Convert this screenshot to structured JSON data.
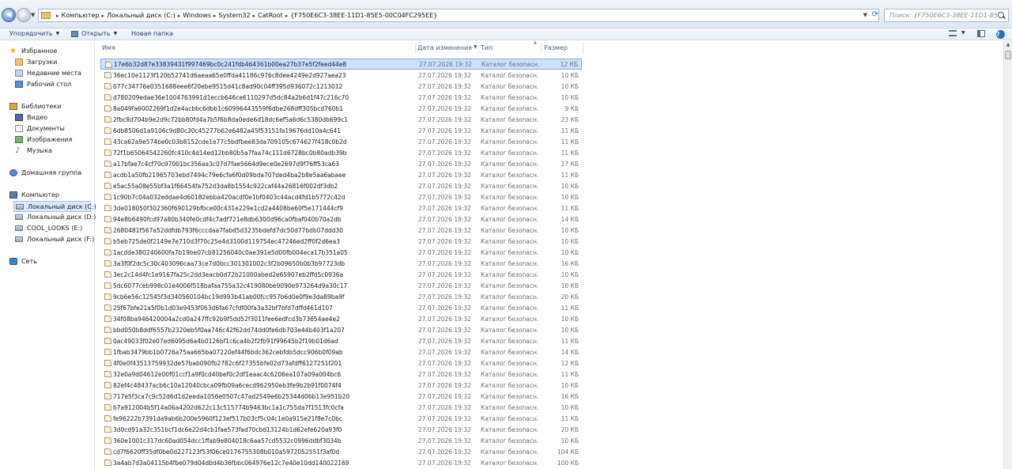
{
  "address": {
    "crumbs": [
      "Компьютер",
      "Локальный диск (C:)",
      "Windows",
      "System32",
      "CatRoot",
      "{F750E6C3-38EE-11D1-85E5-00C04FC295EE}"
    ],
    "search_placeholder": "Поиск: {F750E6C3-38EE-11D1-85E5-00..."
  },
  "toolbar": {
    "organize": "Упорядочить",
    "open": "Открыть",
    "new_folder": "Новая папка"
  },
  "nav": {
    "favorites": "Избранное",
    "downloads": "Загрузки",
    "recent": "Недавние места",
    "desktop": "Рабочий стол",
    "libraries": "Библиотеки",
    "video": "Видео",
    "documents": "Документы",
    "images": "Изображения",
    "music": "Музыка",
    "homegroup": "Домашняя группа",
    "computer": "Компьютер",
    "drive_c": "Локальный диск (C:)",
    "drive_d": "Локальный диск (D:)",
    "drive_e": "COOL_LOOKS (E:)",
    "drive_f": "Локальный диск (F:)",
    "network": "Сеть"
  },
  "columns": {
    "name": "Имя",
    "date": "Дата изменения",
    "type": "Тип",
    "size": "Размер"
  },
  "rows": [
    {
      "name": "17e6b32d87e33839431f997469bc0c241fdb464361b00ea27b37e5f2feed44e8",
      "date": "27.07.2026 19:32",
      "type": "Каталог безопасн...",
      "size": "12 КБ"
    },
    {
      "name": "36ec10e1123f120b52741d6aeaa65e0ffda41186c976c8dee4249e2d927aea23",
      "date": "27.07.2026 19:32",
      "type": "Каталог безопасн...",
      "size": "10 КБ"
    },
    {
      "name": "077c34776e0351688eee6f20ebe9515d41c8ad90c04ff395d936072c1213012",
      "date": "27.07.2026 19:32",
      "type": "Каталог безопасн...",
      "size": "10 КБ"
    },
    {
      "name": "d780209edae36e1004763991d1eccb646ce6110297d5dc84a2b6d1f47c216c70",
      "date": "27.07.2026 19:32",
      "type": "Каталог безопасн...",
      "size": "10 КБ"
    },
    {
      "name": "8a049fa6002269f1d2e4acbbc6dbb1c60996443559f6dbe268dff305bcd760b1",
      "date": "27.07.2026 19:32",
      "type": "Каталог безопасн...",
      "size": "9 КБ"
    },
    {
      "name": "2fbc8d704b9e2d9c72bb80fd4a7b5f6b8da0ede6d18dc6ef5a6d6c5380db699c1",
      "date": "27.07.2026 19:32",
      "type": "Каталог безопасн...",
      "size": "23 КБ"
    },
    {
      "name": "6db8506d1a9106c9d80c30c45277b62e6482a45f53151fa19676dd10a4c641",
      "date": "27.07.2026 19:32",
      "type": "Каталог безопасн...",
      "size": "11 КБ"
    },
    {
      "name": "43ca62a9e574be0c03b8152cde1e77c5bdfbee83da709105c674627f418c0b2d",
      "date": "27.07.2026 19:32",
      "type": "Каталог безопасн...",
      "size": "11 КБ"
    },
    {
      "name": "72f1b65064542260fc410c4d14ed12bb80b5a7faa74c111d6728bc0b80adb39b",
      "date": "27.07.2026 19:32",
      "type": "Каталог безопасн...",
      "size": "11 КБ"
    },
    {
      "name": "a17bfae7c4cf70c97001bc356aa3c07d7fae5664d9ece0e2697d9f76ff53ca63",
      "date": "27.07.2026 19:32",
      "type": "Каталог безопасн...",
      "size": "17 КБ"
    },
    {
      "name": "acdb1a50fb21965703ebd7494c79e6cfa6f0d09bda707ded4ba2b8e5aa6abaee",
      "date": "27.07.2026 19:32",
      "type": "Каталог безопасн...",
      "size": "11 КБ"
    },
    {
      "name": "e5ac55a08e55bf3a1f66454fa752d3da8b1554c922caf44a26816f002df3db2",
      "date": "27.07.2026 19:32",
      "type": "Каталог безопасн...",
      "size": "10 КБ"
    },
    {
      "name": "1c90b7c04a032eddae4d60182ebba420acdf0e1bf0403c44acd4fd1b5772c42d",
      "date": "27.07.2026 19:32",
      "type": "Каталог безопасн...",
      "size": "10 КБ"
    },
    {
      "name": "3de018050f302360f690129bfbce00c431e229e1cd2a4408be60f5e171444cf9",
      "date": "27.07.2026 19:32",
      "type": "Каталог безопасн...",
      "size": "11 КБ"
    },
    {
      "name": "94e8b6490fcd97a80b340fe0cdf4c7adf721e8db6300d96ca0fbaf040b70a2db",
      "date": "27.07.2026 19:32",
      "type": "Каталог безопасн...",
      "size": "14 КБ"
    },
    {
      "name": "2680481f567a52ddfdb793f6cccdaa7fabd5d3235bdefd7dc50d77bdb07ddd30",
      "date": "27.07.2026 19:32",
      "type": "Каталог безопасн...",
      "size": "10 КБ"
    },
    {
      "name": "b5eb725de0f2149e7e710d3f70c25e4d3100d119754ec47246ed2ff0f2d6ea3",
      "date": "27.07.2026 19:32",
      "type": "Каталог безопасн...",
      "size": "10 КБ"
    },
    {
      "name": "1acdde380240600fa7b19be07cb81256040c0ae391e5d00fb004eca17b351a05",
      "date": "27.07.2026 19:32",
      "type": "Каталог безопасн...",
      "size": "10 КБ"
    },
    {
      "name": "3a3f0f2dc5c30c403096caa73ce7d0bcc301301002c3f2b09650b0b3b97723db",
      "date": "27.07.2026 19:32",
      "type": "Каталог безопасн...",
      "size": "16 КБ"
    },
    {
      "name": "3ec2c14d4fc1e9167fa25c2dd3eacb0d72b21000abed2e65907eb2ffd5c0936a",
      "date": "27.07.2026 19:32",
      "type": "Каталог безопасн...",
      "size": "10 КБ"
    },
    {
      "name": "5dc6077ceb998c01e4006f518bafaa755a32c419080be9090e973264d9a30c17",
      "date": "27.07.2026 19:32",
      "type": "Каталог безопасн...",
      "size": "10 КБ"
    },
    {
      "name": "9cb6e56c12545f3d340560104bc19d993b41ab00fcc957b6d0e0f9e3da89ba9f",
      "date": "27.07.2026 19:32",
      "type": "Каталог безопасн...",
      "size": "20 КБ"
    },
    {
      "name": "25f67bfe21a5f0b1d03e9453f063d6fa67cfdf00fa3a32bf7bfd7dffd461d107",
      "date": "27.07.2026 19:32",
      "type": "Каталог безопасн...",
      "size": "11 КБ"
    },
    {
      "name": "34f08ba946420004a2cd0a247ffc92b9f5dd52f3011fee6edfcd3b73654ae4e2",
      "date": "27.07.2026 19:32",
      "type": "Каталог безопасн...",
      "size": "10 КБ"
    },
    {
      "name": "bbd050b8ddf6557b2320eb5f0aa746c42f62dd74dd0fe6db703e44b403f1a207",
      "date": "27.07.2026 19:32",
      "type": "Каталог безопасн...",
      "size": "10 КБ"
    },
    {
      "name": "0ac49033f02e07ed6095d6a4b0126bf1c6ca4b2f2fb91f99645b2f19b01d6ad",
      "date": "27.07.2026 19:32",
      "type": "Каталог безопасн...",
      "size": "11 КБ"
    },
    {
      "name": "1fbab3479bb1b0726a75aa665ba07220ef44f6bdc362cebfdb5dcc906b0f09ab",
      "date": "27.07.2026 19:32",
      "type": "Каталог безопасн...",
      "size": "14 КБ"
    },
    {
      "name": "4f0e0f43513759932de57bab090fb2782c6f27355bfe02d73afdff6127251f201",
      "date": "27.07.2026 19:32",
      "type": "Каталог безопасн...",
      "size": "12 КБ"
    },
    {
      "name": "32e0a9d04612e00f01ccf1a9f0cd40bef0c2df1eaac4c6206ea107a09a004bc6",
      "date": "27.07.2026 19:32",
      "type": "Каталог безопасн...",
      "size": "11 КБ"
    },
    {
      "name": "82ef4c48437acb6c10a12040cbca09fb09a6cecd962950eb3fe9b2b91f0074f4",
      "date": "27.07.2026 19:32",
      "type": "Каталог безопасн...",
      "size": "10 КБ"
    },
    {
      "name": "717e5f3ca7c9c52d6d1d2eeda1056e0507c47ad2549e6b25344d06b13e951b20",
      "date": "27.07.2026 19:32",
      "type": "Каталог безопасн...",
      "size": "16 КБ"
    },
    {
      "name": "b7a912004b5f14a06a4202d622c13c515774b9463bc1a1c755da7f1513fc0cfa",
      "date": "27.07.2026 19:32",
      "type": "Каталог безопасн...",
      "size": "10 КБ"
    },
    {
      "name": "fe96222b7391da9ab6b200e5960f123ef517b03cf5c04c1e0a915e21f8e7c0bc",
      "date": "27.07.2026 19:32",
      "type": "Каталог безопасн...",
      "size": "11 КБ"
    },
    {
      "name": "3d0cd91a32c351bcf1dc6e22d4cb1fae573fad70cbd13124b1d62efe620a93f0",
      "date": "27.07.2026 19:32",
      "type": "Каталог безопасн...",
      "size": "20 КБ"
    },
    {
      "name": "360e1001c317dc60ad054dcc1ffab9e804018c6aa57cd5532c0996ddbf3034b",
      "date": "27.07.2026 19:32",
      "type": "Каталог безопасн...",
      "size": "10 КБ"
    },
    {
      "name": "cd7f6620ff35df0be0d227123f53f06ce0176755308b010a5972052551f3af0d",
      "date": "27.07.2026 19:32",
      "type": "Каталог безопасн...",
      "size": "104 КБ"
    },
    {
      "name": "3a4ab7d3a04115b4fbe079d04dbd4b36fbbc064976e12c7e40e10dd140022169",
      "date": "27.07.2026 19:32",
      "type": "Каталог безопасн...",
      "size": "100 КБ"
    }
  ]
}
